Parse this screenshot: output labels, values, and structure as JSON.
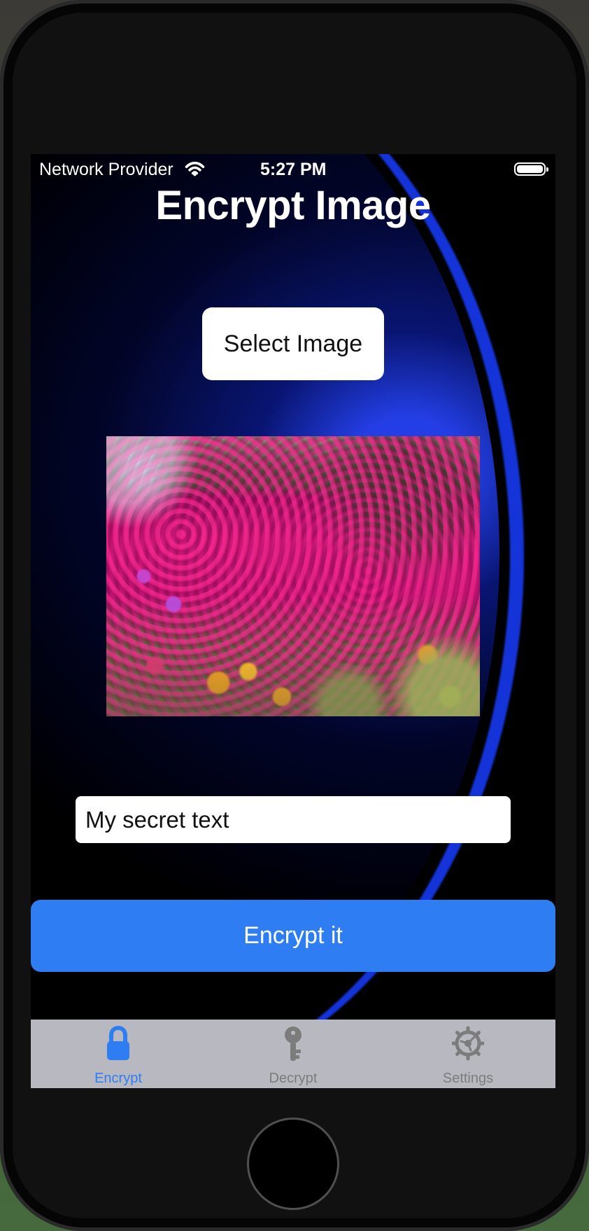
{
  "status_bar": {
    "provider": "Network Provider",
    "time": "5:27 PM",
    "wifi_icon": "wifi-icon",
    "battery_icon": "battery-icon"
  },
  "screen": {
    "title": "Encrypt Image",
    "select_button": "Select Image",
    "image_icon": "flower-photo",
    "input": {
      "value": "My secret text",
      "placeholder": ""
    },
    "encrypt_button": "Encrypt it"
  },
  "tabs": [
    {
      "label": "Encrypt",
      "icon": "lock-icon",
      "color": "#2f7df2"
    },
    {
      "label": "Decrypt",
      "icon": "key-icon",
      "color": "#7c7c7c"
    },
    {
      "label": "Settings",
      "icon": "gear-icon",
      "color": "#7c7c7c"
    }
  ],
  "colors": {
    "accent": "#2f7df2",
    "background": "#000000",
    "tab_bar": "#b8b8c0"
  }
}
